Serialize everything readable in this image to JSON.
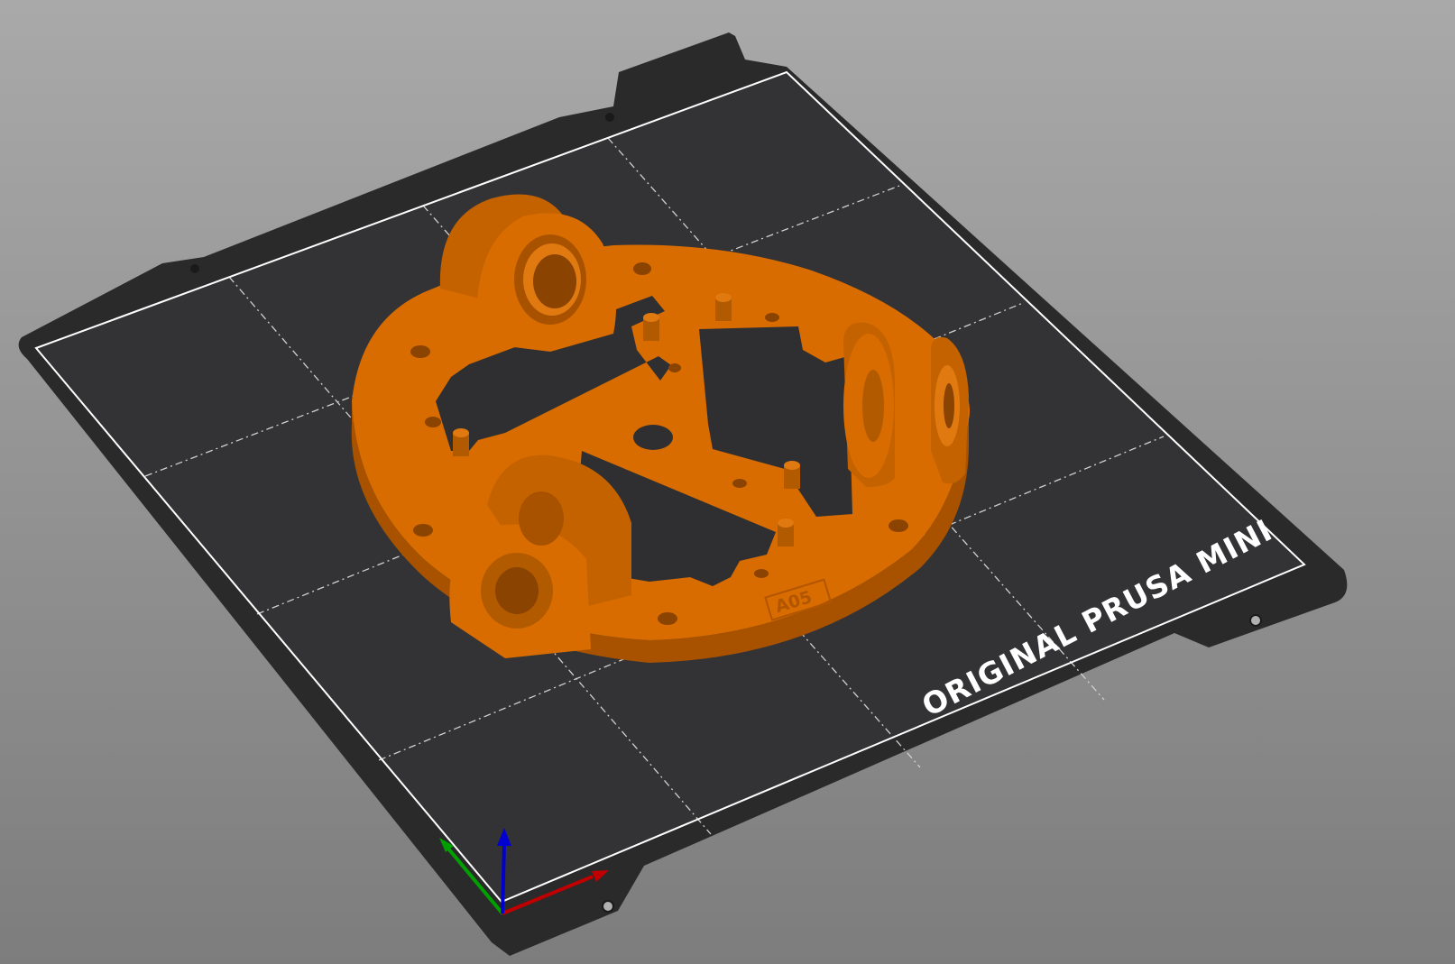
{
  "viewport": {
    "background_top": "#a9a9a9",
    "background_bottom": "#7d7d7d"
  },
  "bed": {
    "label": "ORIGINAL PRUSA MINI",
    "color": "#2a2a2a",
    "grid_color": "#3e3e3e",
    "outline_color": "#ffffff"
  },
  "model": {
    "color": "#d86c00",
    "shade_color": "#a85200",
    "highlight_color": "#ec8a1e",
    "part_label": "A05"
  },
  "axes": {
    "x_color": "#c00000",
    "y_color": "#00a000",
    "z_color": "#0000d0"
  }
}
